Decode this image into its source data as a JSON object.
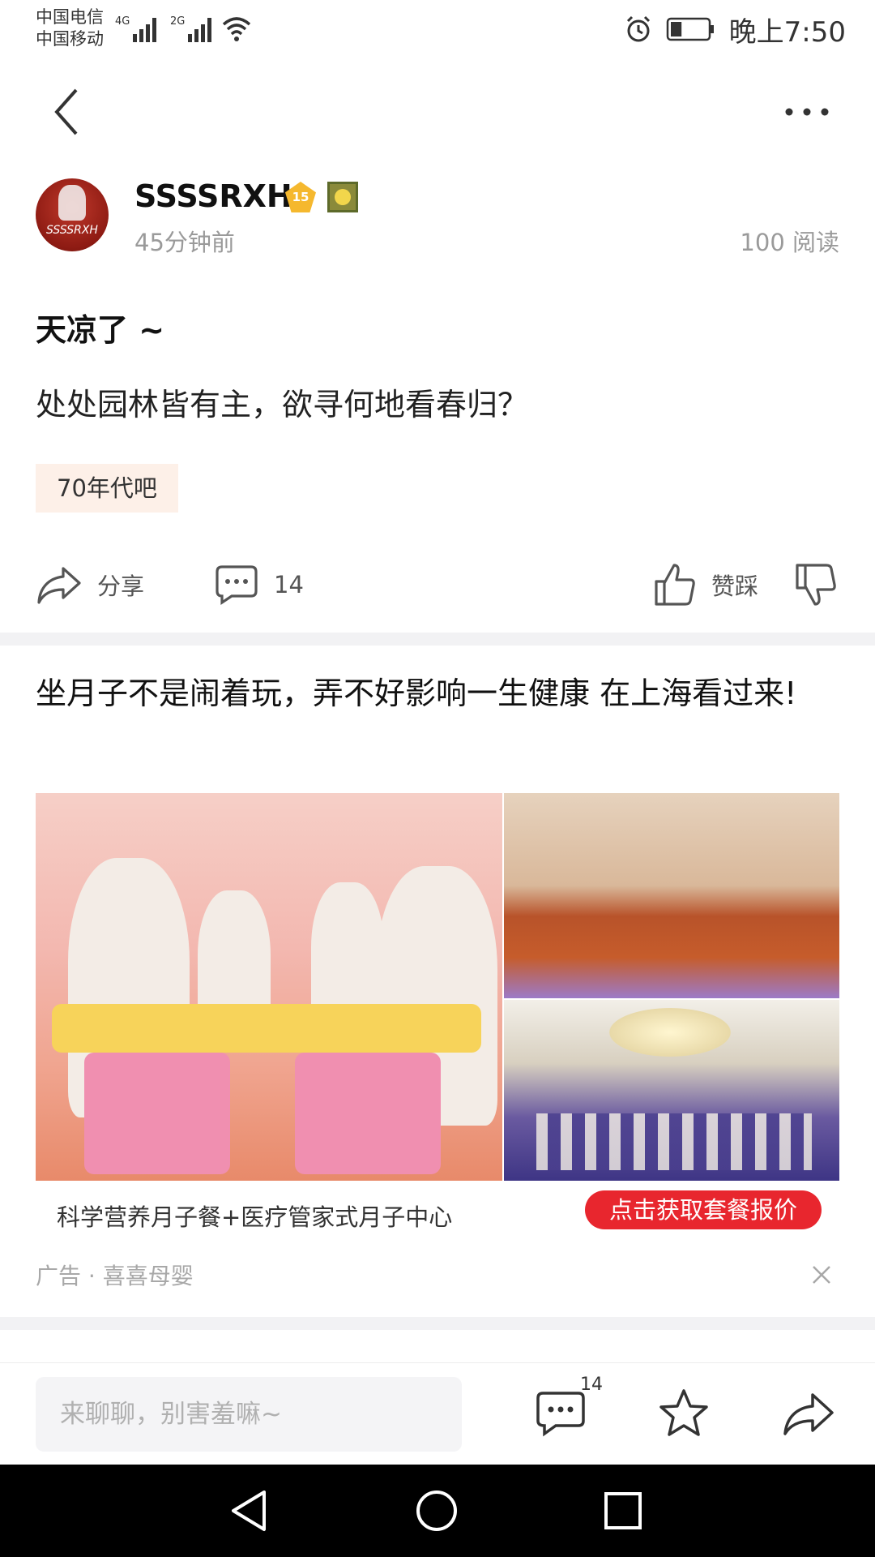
{
  "status_bar": {
    "carrier_1": "中国电信",
    "carrier_2": "中国移动",
    "network_1": "4G",
    "network_2": "2G",
    "time": "晚上7:50",
    "battery_level": 0.3
  },
  "author": {
    "name": "SSSSRXH",
    "level": "15",
    "avatar_text": "SSSSRXH",
    "time_ago": "45分钟前",
    "reads": "100 阅读"
  },
  "post": {
    "title": "天凉了 ~",
    "content": "处处园林皆有主，欲寻何地看春归？",
    "tag": "70年代吧"
  },
  "actions": {
    "share_label": "分享",
    "comment_count": "14",
    "vote_label": "赞踩"
  },
  "ad": {
    "title": "坐月子不是闹着玩，弄不好影响一生健康 在上海看过来!",
    "caption": "科学营养月子餐+医疗管家式月子中心",
    "cta": "点击获取套餐报价",
    "source": "广告 · 喜喜母婴"
  },
  "bottom_bar": {
    "input_placeholder": "来聊聊，别害羞嘛~",
    "comment_count": "14"
  },
  "colors": {
    "accent_red": "#e8262e",
    "tag_bg": "#fdf0e8",
    "muted_text": "#9a9a9a"
  }
}
